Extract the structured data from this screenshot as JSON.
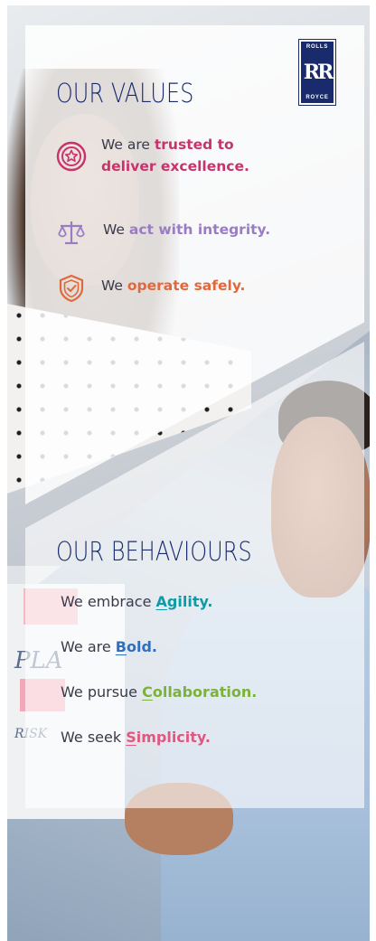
{
  "values_section": {
    "heading": "OUR VALUES",
    "items": [
      {
        "prefix": "We are ",
        "highlight": "trusted to deliver excellence.",
        "suffix": "",
        "color": "#c8336c",
        "icon": "star-badge-icon"
      },
      {
        "prefix": "We ",
        "highlight": "act with integrity.",
        "suffix": "",
        "color": "#9a7cc4",
        "icon": "scales-icon"
      },
      {
        "prefix": "We ",
        "highlight": "operate safely.",
        "suffix": "",
        "color": "#e1683b",
        "icon": "shield-check-icon"
      }
    ]
  },
  "behaviours_section": {
    "heading": "OUR BEHAVIOURS",
    "items": [
      {
        "prefix": "We embrace ",
        "highlight_first": "A",
        "highlight_rest": "gility.",
        "color": "#0e9aa7"
      },
      {
        "prefix": "We are ",
        "highlight_first": "B",
        "highlight_rest": "old.",
        "color": "#2f6fc1"
      },
      {
        "prefix": "We pursue ",
        "highlight_first": "C",
        "highlight_rest": "ollaboration.",
        "color": "#7bb33a"
      },
      {
        "prefix": "We seek ",
        "highlight_first": "S",
        "highlight_rest": "implicity.",
        "color": "#e0577f"
      }
    ]
  },
  "logo": {
    "top_text": "ROLLS",
    "monogram": "RR",
    "bottom_text": "ROYCE",
    "color": "#1a2b6d"
  },
  "background": {
    "whiteboard_text_1": "PLA",
    "whiteboard_text_2": "RISK"
  },
  "colors": {
    "heading": "#1a2b6d",
    "body_text": "#3a3a48"
  }
}
